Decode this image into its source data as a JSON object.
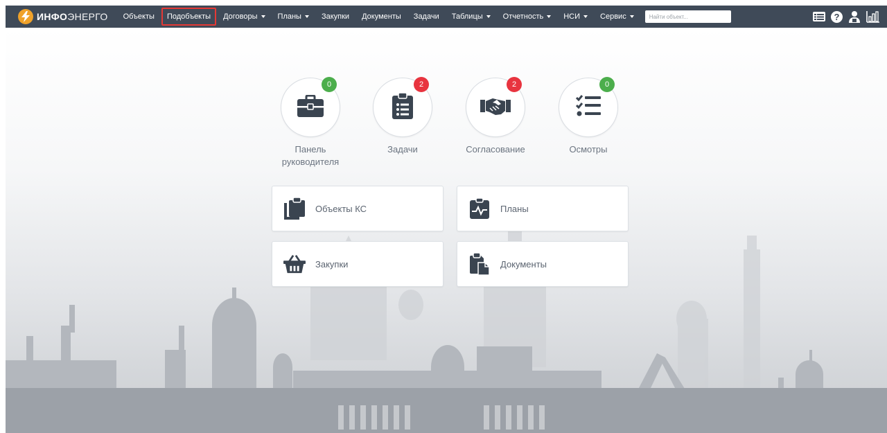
{
  "navbar": {
    "logo_bold": "ИНФО",
    "logo_light": "ЭНЕРГО",
    "items": [
      {
        "label": "Объекты",
        "dropdown": false
      },
      {
        "label": "Подобъекты",
        "dropdown": false,
        "highlighted": true
      },
      {
        "label": "Договоры",
        "dropdown": true
      },
      {
        "label": "Планы",
        "dropdown": true
      },
      {
        "label": "Закупки",
        "dropdown": false
      },
      {
        "label": "Документы",
        "dropdown": false
      },
      {
        "label": "Задачи",
        "dropdown": false
      },
      {
        "label": "Таблицы",
        "dropdown": true
      },
      {
        "label": "Отчетность",
        "dropdown": true
      },
      {
        "label": "НСИ",
        "dropdown": true
      },
      {
        "label": "Сервис",
        "dropdown": true
      }
    ],
    "search_placeholder": "Найти объект...",
    "right_icons": [
      "list-icon",
      "help-icon",
      "user-icon",
      "chart-icon"
    ]
  },
  "quick_links": [
    {
      "label": "Панель руководителя",
      "icon": "briefcase-icon",
      "badge": "0",
      "badge_color": "#4cae4c"
    },
    {
      "label": "Задачи",
      "icon": "clipboard-list-icon",
      "badge": "2",
      "badge_color": "#e8343f"
    },
    {
      "label": "Согласование",
      "icon": "handshake-icon",
      "badge": "2",
      "badge_color": "#e8343f"
    },
    {
      "label": "Осмотры",
      "icon": "checklist-icon",
      "badge": "0",
      "badge_color": "#4cae4c"
    }
  ],
  "tiles": [
    {
      "label": "Объекты КС",
      "icon": "clipboard-copy-icon"
    },
    {
      "label": "Планы",
      "icon": "pulse-chart-icon"
    },
    {
      "label": "Закупки",
      "icon": "basket-icon"
    },
    {
      "label": "Документы",
      "icon": "documents-icon"
    }
  ],
  "colors": {
    "navbar": "#3f4a58",
    "logo_accent": "#f0a22a",
    "highlight": "#e53935",
    "icon_dark": "#3a4450",
    "label_text": "#6b7480"
  }
}
